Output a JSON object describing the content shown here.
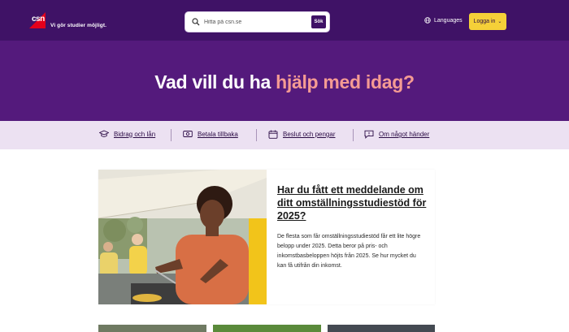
{
  "header": {
    "logo_text": "csn",
    "tagline": "Vi gör studier möjligt.",
    "search": {
      "placeholder": "Hitta på csn.se",
      "button_label": "Sök"
    },
    "languages_label": "Languages",
    "login_label": "Logga in"
  },
  "hero": {
    "title_part1": "Vad vill du ha ",
    "title_part2": "hjälp med idag?"
  },
  "nav": {
    "items": [
      {
        "label": "Bidrag och lån",
        "icon": "graduation-cap-icon"
      },
      {
        "label": "Betala tillbaka",
        "icon": "money-icon"
      },
      {
        "label": "Beslut och pengar",
        "icon": "calendar-icon"
      },
      {
        "label": "Om något händer",
        "icon": "message-icon"
      }
    ]
  },
  "featured": {
    "title": "Har du fått ett meddelande om ditt omställningsstudiestöd för 2025?",
    "text": "De flesta som får omställningsstudiestöd får ett lite högre belopp under 2025. Detta beror på pris- och inkomstbasbeloppen höjts från 2025. Se hur mycket du kan få utifrån din inkomst."
  },
  "colors": {
    "header_bg": "#3f1266",
    "hero_bg": "#541a7c",
    "accent_pink": "#f59b93",
    "login_yellow": "#f5d038",
    "nav_bg": "#ece1f2",
    "logo_red": "#e3001b"
  }
}
